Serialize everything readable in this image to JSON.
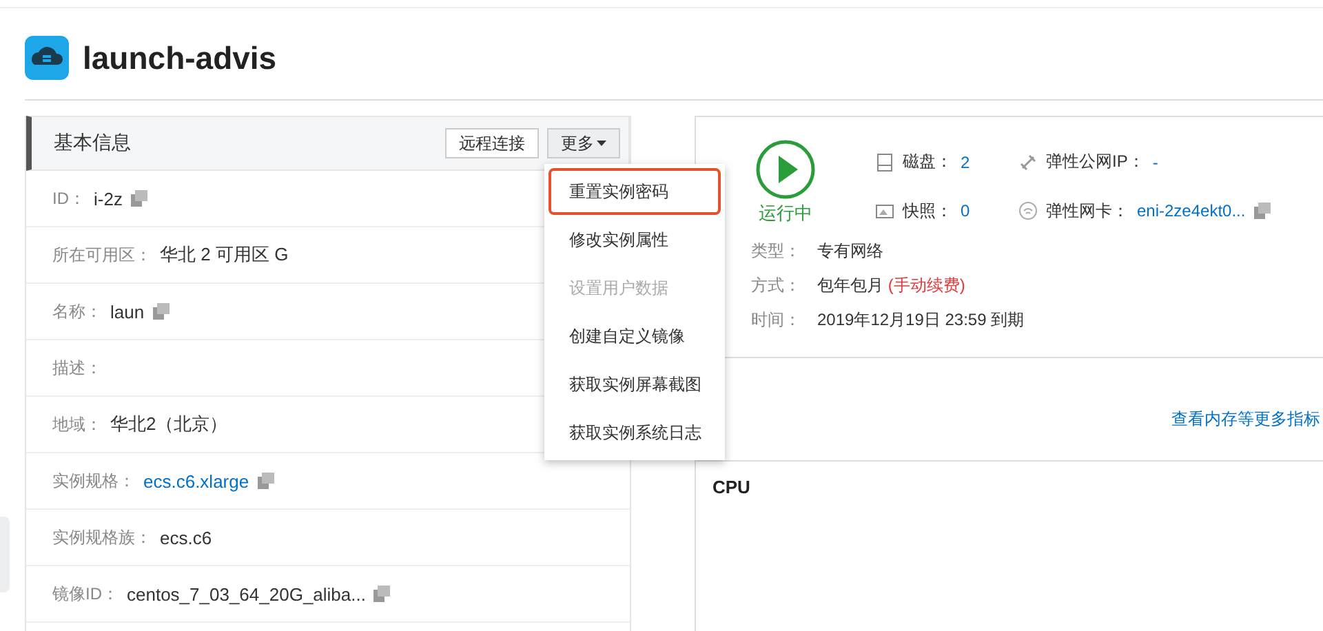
{
  "title": "launch-advis",
  "basic_info": {
    "heading": "基本信息",
    "buttons": [
      {
        "label": "远程连接",
        "kind": "plain"
      },
      {
        "label": "更多",
        "kind": "dropdown"
      }
    ],
    "rows": [
      {
        "label": "ID：",
        "value": "i-2z",
        "copy": true,
        "link": false
      },
      {
        "label": "所在可用区：",
        "value": "华北 2 可用区 G",
        "copy": false,
        "link": false
      },
      {
        "label": "名称：",
        "value": "laun",
        "copy": true,
        "link": false
      },
      {
        "label": "描述："
      },
      {
        "label": "地域：",
        "value": "华北2（北京）",
        "copy": false,
        "link": false
      },
      {
        "label": "实例规格：",
        "value": "ecs.c6.xlarge",
        "copy": true,
        "link": true
      },
      {
        "label": "实例规格族：",
        "value": "ecs.c6",
        "copy": false,
        "link": false
      },
      {
        "label": "镜像ID：",
        "value": "centos_7_03_64_20G_aliba...",
        "copy": true,
        "link": false
      }
    ]
  },
  "more_menu": [
    {
      "label": "重置实例密码",
      "selected": true,
      "disabled": false
    },
    {
      "label": "修改实例属性",
      "selected": false,
      "disabled": false
    },
    {
      "label": "设置用户数据",
      "selected": false,
      "disabled": true
    },
    {
      "label": "创建自定义镜像",
      "selected": false,
      "disabled": false
    },
    {
      "label": "获取实例屏幕截图",
      "selected": false,
      "disabled": false
    },
    {
      "label": "获取实例系统日志",
      "selected": false,
      "disabled": false
    }
  ],
  "status": {
    "label": "运行中",
    "resources": [
      {
        "kind": "disk",
        "label": "磁盘：",
        "value": "2",
        "copy": false
      },
      {
        "kind": "eip",
        "label": "弹性公网IP：",
        "value": "-",
        "copy": false
      },
      {
        "kind": "snapshot",
        "label": "快照：",
        "value": "0",
        "copy": false
      },
      {
        "kind": "eni",
        "label": "弹性网卡：",
        "value": "eni-2ze4ekt0...",
        "copy": true
      }
    ],
    "details": [
      {
        "label": "类型：",
        "value": "专有网络"
      },
      {
        "label": "方式：",
        "value": "包年包月",
        "note": "(手动续费)"
      },
      {
        "label": "时间：",
        "value": "2019年12月19日 23:59 到期"
      }
    ]
  },
  "monitor_link": "查看内存等更多指标",
  "cpu_card": {
    "title": "CPU"
  }
}
